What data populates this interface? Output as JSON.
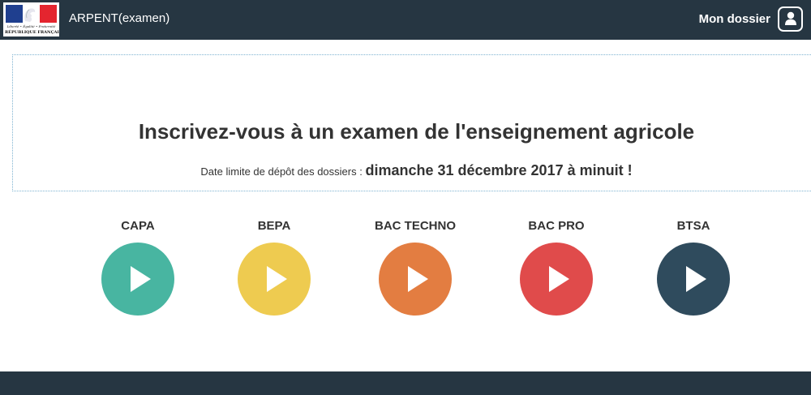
{
  "header": {
    "logo": {
      "motto": "Liberté • Égalité • Fraternité",
      "name": "RÉPUBLIQUE FRANÇAISE",
      "colors": [
        "#1f3f8f",
        "#ffffff",
        "#e4252f"
      ]
    },
    "app_title": "ARPENT(examen)",
    "account_label": "Mon dossier",
    "account_icon": "user-icon",
    "background": "#263642"
  },
  "hero": {
    "title": "Inscrivez-vous à un examen de l'enseignement agricole",
    "deadline_label": "Date limite de dépôt des dossiers : ",
    "deadline_date": "dimanche 31 décembre 2017 à minuit !"
  },
  "exams": [
    {
      "label": "CAPA",
      "color": "#48b5a1",
      "icon": "play-icon"
    },
    {
      "label": "BEPA",
      "color": "#eecb50",
      "icon": "play-icon"
    },
    {
      "label": "BAC TECHNO",
      "color": "#e37d41",
      "icon": "play-icon"
    },
    {
      "label": "BAC PRO",
      "color": "#e04b4b",
      "icon": "play-icon"
    },
    {
      "label": "BTSA",
      "color": "#2f4b5d",
      "icon": "play-icon"
    }
  ],
  "footer": {
    "background": "#263642"
  }
}
